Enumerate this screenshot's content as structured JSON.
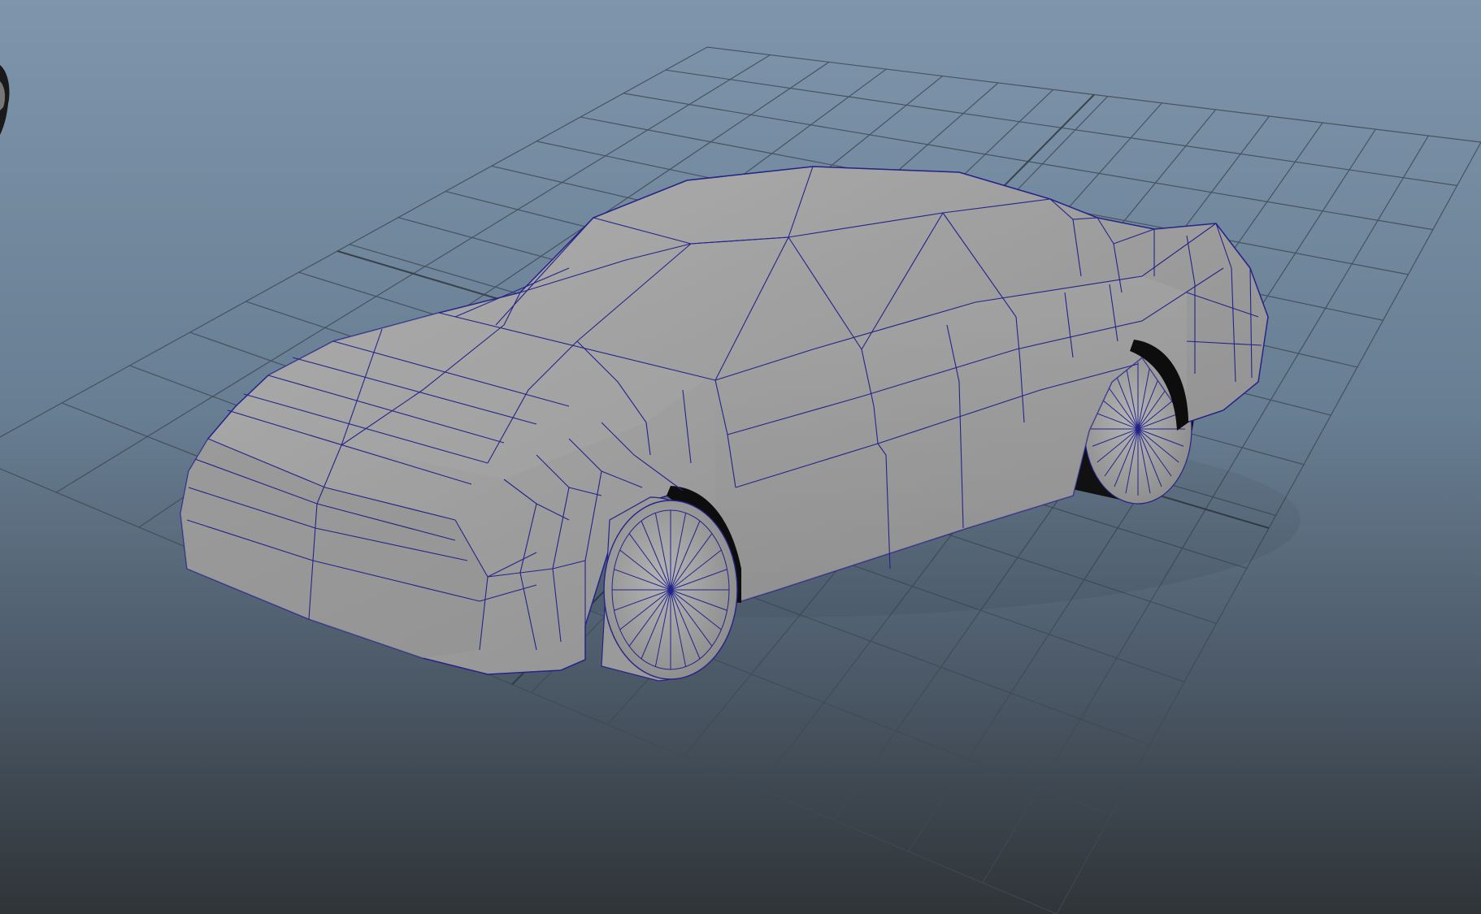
{
  "viewport": {
    "gradient_top": "#7f95ab",
    "gradient_mid": "#58697c",
    "gradient_bottom": "#2f3438",
    "grid_line_color": "#3f4a55",
    "grid_axis_color": "#2f363c"
  },
  "model": {
    "shape": "low-poly car",
    "surface_color": "#9a9a9a",
    "wireframe_color": "#24238a",
    "tire_color": "#111111"
  },
  "offscreen_object": {
    "color": "#1a1a1a"
  }
}
